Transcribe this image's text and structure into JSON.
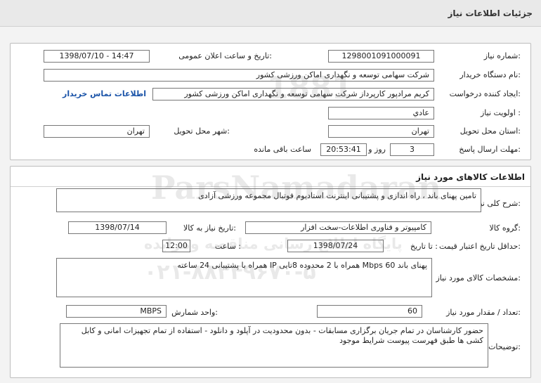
{
  "header": {
    "title": "جزئیات اطلاعات نیاز"
  },
  "info": {
    "need_number_label": "شماره نیاز:",
    "need_number": "1298001091000091",
    "announce_label": "تاریخ و ساعت اعلان عمومی:",
    "announce_value": "1398/07/10 - 14:47",
    "buyer_label": "نام دستگاه خریدار:",
    "buyer_value": "شرکت سهامی توسعه و نگهداری اماکن ورزشی کشور",
    "creator_label": "ایجاد کننده درخواست:",
    "creator_value": "کریم مرادپور کارپرداز شرکت سهامی توسعه و نگهداری اماکن ورزشی کشور",
    "contact_link": "اطلاعات تماس خریدار",
    "priority_label": "اولویت نیاز :",
    "priority_value": "عادي",
    "province_label": "استان محل تحویل:",
    "province_value": "تهران",
    "city_label": "شهر محل تحویل:",
    "city_value": "تهران",
    "deadline_label": "مهلت ارسال پاسخ:",
    "deadline_days": "3",
    "days_and": "روز و",
    "deadline_time": "20:53:41",
    "remaining": "ساعت باقی مانده"
  },
  "goods": {
    "section_title": "اطلاعات کالاهای مورد نیاز",
    "desc_label": "شرح کلی نیاز:",
    "desc_value": "تامین پهنای باند ، راه اندازی و پشتیبانی اینترنت استادیوم فوتبال مجموعه ورزشی آزادی",
    "group_label": "گروه کالا:",
    "group_value": "کامپیوتر و فناوری اطلاعات-سخت افزار",
    "need_date_label": "تاریخ نیاز به کالا:",
    "need_date_value": "1398/07/14",
    "validity_label": "حداقل تاریخ اعتبار قیمت:",
    "until_label": "تا تاریخ :",
    "validity_date": "1398/07/24",
    "time_label": "ساعت :",
    "validity_time": "12:00",
    "spec_label": "مشخصات کالای مورد نیاز:",
    "spec_value": "پهنای باند 60 Mbps همراه با 2 محدوده 8تایی IP همراه با پشتیبانی 24 ساعته",
    "qty_label": "تعداد / مقدار مورد نیاز:",
    "qty_value": "60",
    "unit_label": "واحد شمارش:",
    "unit_value": "MBPS",
    "notes_label": "توضیحات خریدار:",
    "notes_value": "حضور کارشناسان در تمام جریان برگزاری مسابقات - بدون محدودیت در آپلود و دانلود - استفاده از تمام تجهیزات امانی و کابل کشی ها طبق فهرست پیوست شرایط موجود"
  },
  "watermark": {
    "line1": "ParsNamadaran",
    "line2": "پایگاه اطلاع رسانی مناقصه ومزایده",
    "line3": "۰۲۱-۸۸۳۴۹۶۷۰-۵",
    "line4": "1881"
  }
}
